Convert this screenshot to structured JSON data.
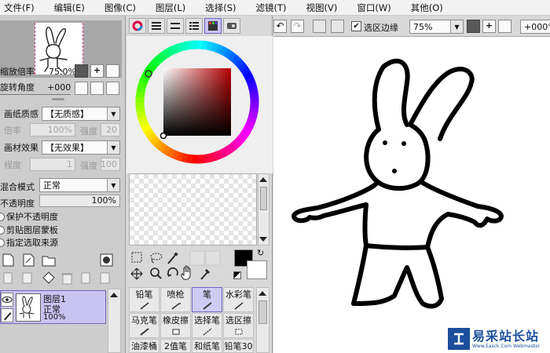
{
  "menu": {
    "items": [
      "文件(F)",
      "编辑(E)",
      "图像(C)",
      "图层(L)",
      "选择(S)",
      "滤镜(T)",
      "视图(V)",
      "窗口(W)",
      "其他(O)"
    ]
  },
  "navigator": {
    "zoom_label": "缩放倍率",
    "zoom_value": "75.0%",
    "rotate_label": "旋转角度",
    "rotate_value": "+000"
  },
  "paper_texture": {
    "label": "画纸质感",
    "value": "【无质感】",
    "scale_label": "倍率",
    "scale_value": "100%",
    "strength_label": "强度",
    "strength_value": "20"
  },
  "effect": {
    "label": "画材效果",
    "value": "【无效果】",
    "degree_label": "程度",
    "degree_value": "1",
    "strength_label": "强度",
    "strength_value": "100"
  },
  "blend": {
    "label": "混合模式",
    "value": "正常",
    "opacity_label": "不透明度",
    "opacity_value": "100%",
    "opacity_fraction": 1.0
  },
  "layer_options": {
    "protect_opacity": "保护不透明度",
    "clip_layer": "剪贴图层蒙板",
    "selection_source": "指定选取来源"
  },
  "layers": [
    {
      "name": "图层1",
      "mode": "正常",
      "opacity": "100%"
    }
  ],
  "toolbar": {
    "selection_edge_label": "选区边缘",
    "selection_edge_checked": true,
    "zoom_value": "75%",
    "rotate_value": "+000°"
  },
  "brushes": [
    {
      "label": "铅笔",
      "selected": false
    },
    {
      "label": "喷枪",
      "selected": false
    },
    {
      "label": "笔",
      "selected": true
    },
    {
      "label": "水彩笔",
      "selected": false
    },
    {
      "label": "马克笔",
      "selected": false
    },
    {
      "label": "橡皮擦",
      "selected": false
    },
    {
      "label": "选择笔",
      "selected": false
    },
    {
      "label": "选区擦",
      "selected": false
    },
    {
      "label": "油漆桶",
      "selected": false
    },
    {
      "label": "2值笔",
      "selected": false
    },
    {
      "label": "和纸笔",
      "selected": false
    },
    {
      "label": "铅笔30",
      "selected": false
    }
  ],
  "colors": {
    "primary": "#000000",
    "secondary": "#ffffff",
    "picker_hue": "#b70000",
    "layer_selected": "#c9c3f2",
    "watermark_blue": "#1c4f9c"
  },
  "watermark": {
    "main": "易采站长站",
    "url": "Www.Easck.Com Webmaster"
  }
}
